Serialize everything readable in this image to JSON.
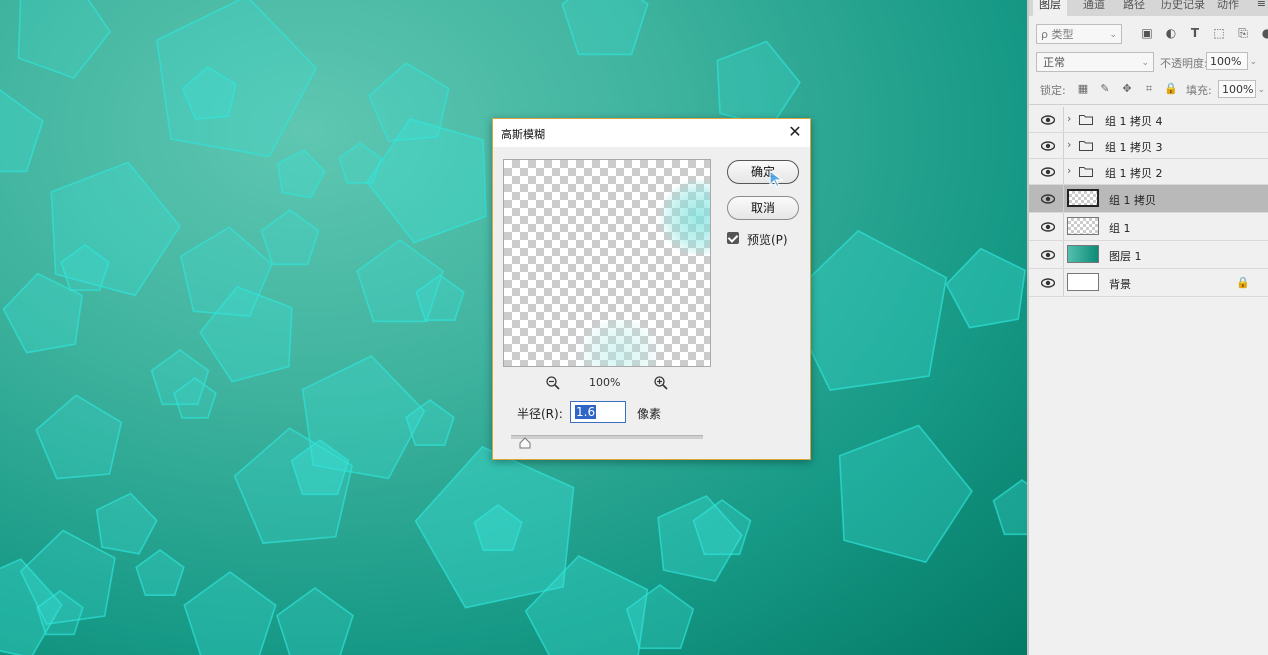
{
  "panel": {
    "tabs": [
      "图层",
      "通道",
      "路径",
      "历史记录",
      "动作"
    ],
    "filter_kind": "ρ 类型",
    "blend_mode": "正常",
    "opacity_label": "不透明度:",
    "opacity_value": "100%",
    "lock_label": "锁定:",
    "fill_label": "填充:",
    "fill_value": "100%",
    "layers": [
      {
        "name": "组 1 拷贝 4",
        "type": "group"
      },
      {
        "name": "组 1 拷贝 3",
        "type": "group"
      },
      {
        "name": "组 1 拷贝 2",
        "type": "group"
      },
      {
        "name": "组 1 拷贝",
        "type": "layer",
        "selected": true
      },
      {
        "name": "组 1",
        "type": "layer"
      },
      {
        "name": "图层 1",
        "type": "layer"
      },
      {
        "name": "背景",
        "type": "background",
        "locked": true
      }
    ]
  },
  "dialog": {
    "title": "高斯模糊",
    "ok_label": "确定",
    "cancel_label": "取消",
    "preview_label": "预览(P)",
    "zoom_value": "100%",
    "radius_label": "半径(R):",
    "radius_value": "1.6",
    "radius_unit": "像素"
  },
  "colors": {
    "canvas_light": "#5fc7b2",
    "canvas_dark": "#047a66",
    "pentagon_stroke": "#2ee6dc",
    "dialog_border": "#d6a93f",
    "selection": "#2f66c6"
  }
}
